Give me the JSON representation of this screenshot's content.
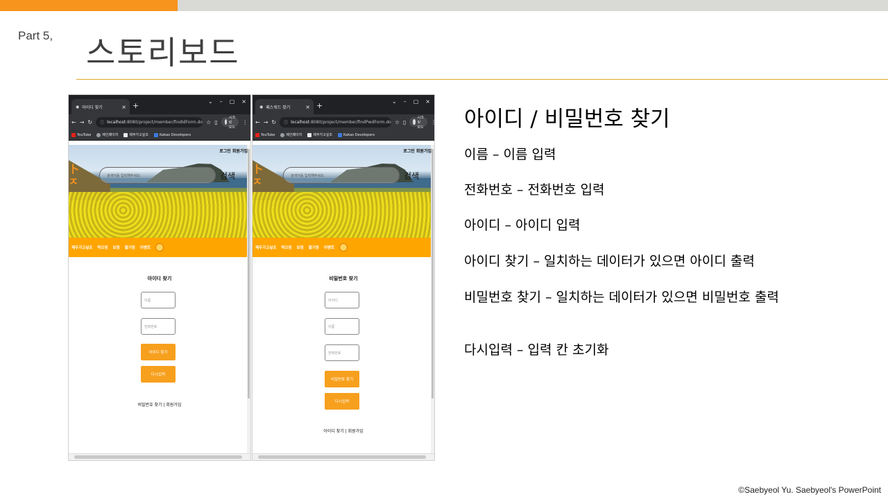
{
  "slide": {
    "part_label": "Part  5,",
    "title": "스토리보드",
    "footer": "©Saebyeol Yu. Saebyeol's PowerPoint"
  },
  "colors": {
    "accent_orange": "#f7941d",
    "rule_gold": "#e0a528",
    "top_gray": "#d9d9d6",
    "nav_orange": "#ffa500"
  },
  "browser_id": {
    "tab_title": "아이디 찾기",
    "url_host": "localhost",
    "url_rest": ":8080/project/member/findIdForm.do",
    "profile": "시크릿 모드",
    "bookmarks": [
      "YouTube",
      "메인페이지",
      "제주가고싶조",
      "Kakao Developers"
    ],
    "login_links": "로그인 회원가입",
    "search_placeholder": "검색어를 입력해주세요.",
    "search_button": "검색",
    "nav_items": [
      "제주가고싶조",
      "먹으밍",
      "보밍",
      "즐기밍",
      "이벤트"
    ],
    "form_title": "아이디 찾기",
    "fields": [
      "이름",
      "전화번호"
    ],
    "buttons": [
      "아이디 찾기",
      "다시입력"
    ],
    "bottom_link": "비밀번호 찾기 | 회원가입"
  },
  "browser_pw": {
    "tab_title": "패스워드 찾기",
    "url_host": "localhost",
    "url_rest": ":8080/project/member/findPwdForm.do",
    "profile": "시크릿 모드",
    "bookmarks": [
      "YouTube",
      "메인페이지",
      "제주가고싶조",
      "Kakao Developers"
    ],
    "login_links": "로그인 회원가입",
    "search_placeholder": "검색어를 입력해주세요.",
    "search_button": "검색",
    "nav_items": [
      "제주가고싶조",
      "먹으밍",
      "보밍",
      "즐기밍",
      "이벤트"
    ],
    "form_title": "비밀번호 찾기",
    "fields": [
      "아이디",
      "이름",
      "전화번호"
    ],
    "buttons": [
      "비밀번호 찾기",
      "다시입력"
    ],
    "bottom_link": "아이디 찾기 | 회원가입"
  },
  "description": {
    "heading": "아이디 / 비밀번호 찾기",
    "lines": [
      "이름 – 이름 입력",
      "전화번호 – 전화번호 입력",
      "아이디 – 아이디 입력",
      "아이디 찾기 – 일치하는 데이터가 있으면 아이디 출력",
      "비밀번호 찾기 – 일치하는 데이터가 있으면 비밀번호 출력",
      "다시입력 – 입력 칸 초기화"
    ]
  }
}
